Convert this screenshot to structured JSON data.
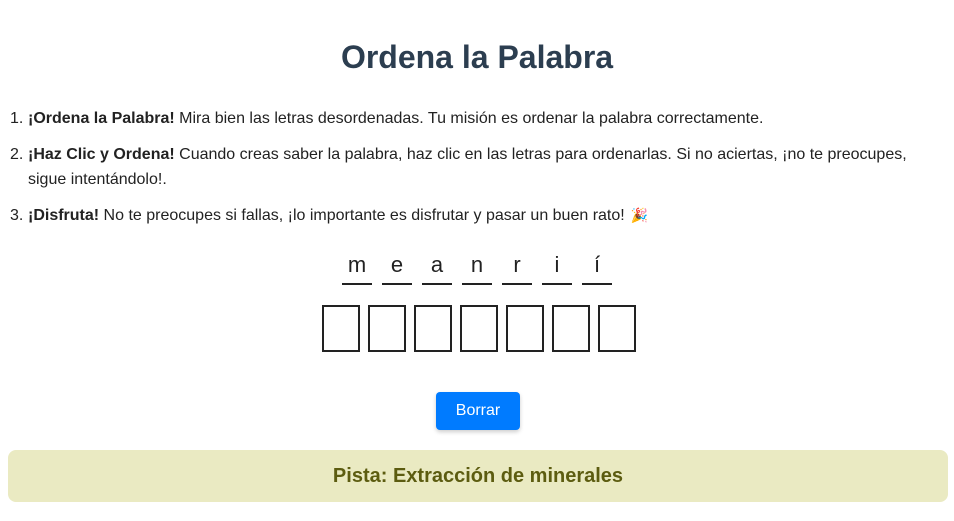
{
  "title": "Ordena la Palabra",
  "instructions": [
    {
      "number": "1.",
      "bold": "¡Ordena la Palabra!",
      "text": " Mira bien las letras desordenadas. Tu misión es ordenar la palabra correctamente."
    },
    {
      "number": "2.",
      "bold": "¡Haz Clic y Ordena!",
      "text": " Cuando creas saber la palabra, haz clic en las letras para ordenarlas. Si no aciertas, ¡no te preocupes, sigue intentándolo!."
    },
    {
      "number": "3.",
      "bold": "¡Disfruta!",
      "text": " No te preocupes si fallas, ¡lo importante es disfrutar y pasar un buen rato!",
      "icon": "party-popper-icon",
      "glyph": "🎉"
    }
  ],
  "scrambled_letters": [
    "m",
    "e",
    "a",
    "n",
    "r",
    "i",
    "í"
  ],
  "answer_slots": [
    "",
    "",
    "",
    "",
    "",
    "",
    ""
  ],
  "clear_button": "Borrar",
  "hint": "Pista: Extracción de minerales",
  "colors": {
    "title": "#2c3e50",
    "button": "#007bff",
    "hint_background": "#eaeac2",
    "hint_text": "#5c5c10"
  }
}
